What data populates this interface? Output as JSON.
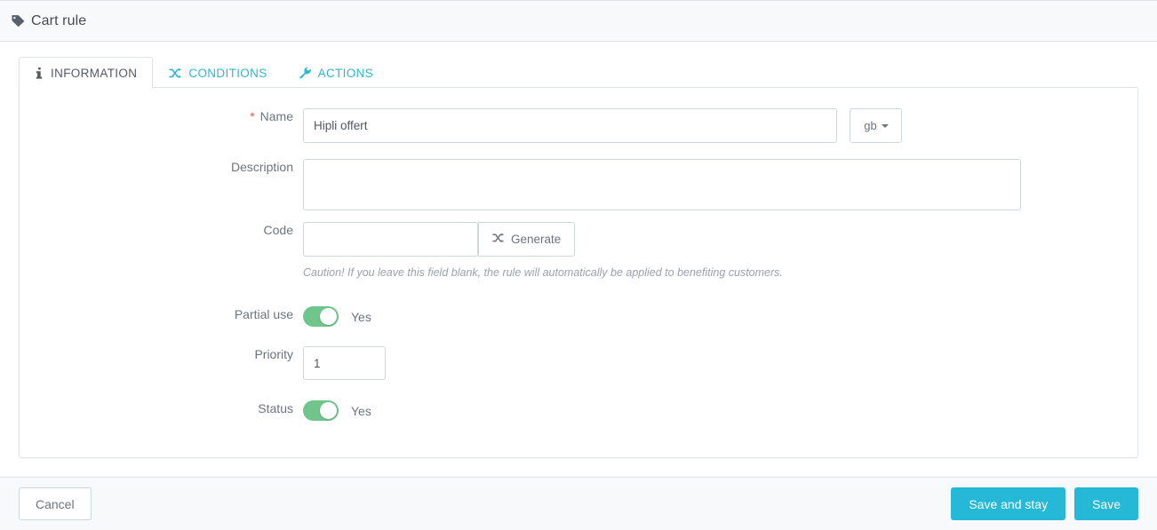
{
  "header": {
    "title": "Cart rule",
    "icon": "tag-icon"
  },
  "tabs": [
    {
      "label": "INFORMATION",
      "icon": "info-icon",
      "active": true
    },
    {
      "label": "CONDITIONS",
      "icon": "shuffle-icon",
      "active": false
    },
    {
      "label": "ACTIONS",
      "icon": "wrench-icon",
      "active": false
    }
  ],
  "form": {
    "name": {
      "label": "Name",
      "required_marker": "*",
      "value": "Hipli offert",
      "placeholder": "",
      "language_button": "gb"
    },
    "description": {
      "label": "Description",
      "value": "",
      "placeholder": ""
    },
    "code": {
      "label": "Code",
      "value": "",
      "placeholder": "",
      "generate_label": "Generate",
      "generate_icon": "shuffle-icon",
      "hint": "Caution! If you leave this field blank, the rule will automatically be applied to benefiting customers."
    },
    "partial_use": {
      "label": "Partial use",
      "state_label": "Yes",
      "enabled": true
    },
    "priority": {
      "label": "Priority",
      "value": "1",
      "placeholder": ""
    },
    "status": {
      "label": "Status",
      "state_label": "Yes",
      "enabled": true
    }
  },
  "footer": {
    "cancel_label": "Cancel",
    "save_and_stay_label": "Save and stay",
    "save_label": "Save"
  },
  "colors": {
    "accent": "#25b9d7",
    "tab_link": "#2fb6d4",
    "toggle_on": "#6fc58b",
    "required": "#f5564e",
    "header_bg": "#f7f9fa",
    "border": "#dfe4e8"
  }
}
